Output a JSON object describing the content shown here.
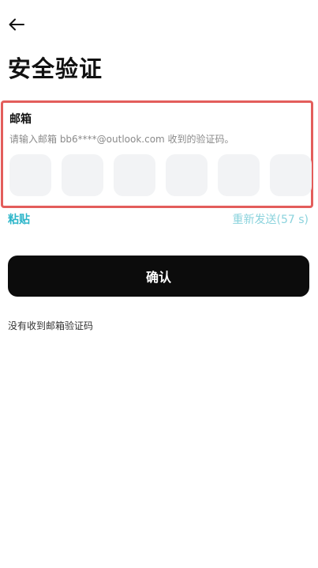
{
  "header": {
    "back_icon": "arrow-left-icon",
    "title": "安全验证"
  },
  "verification": {
    "label": "邮箱",
    "hint": "请输入邮箱 bb6****@outlook.com 收到的验证码。",
    "highlight_color": "#e35d5b",
    "code_cells": [
      "",
      "",
      "",
      "",
      "",
      ""
    ]
  },
  "actions": {
    "paste_label": "粘贴",
    "paste_color": "#2bb5c9",
    "resend_label": "重新发送(57 s)",
    "confirm_label": "确认",
    "no_code_label": "没有收到邮箱验证码"
  }
}
